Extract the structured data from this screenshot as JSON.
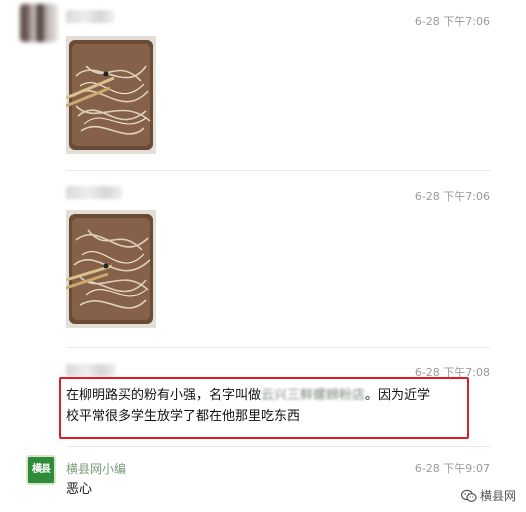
{
  "messages": [
    {
      "time": "6-28 下午7:06"
    },
    {
      "time": "6-28 下午7:06"
    },
    {
      "time": "6-28 下午7:08",
      "text_before": "在柳明路买的粉有小强，名字叫做",
      "text_redacted": "云兴三鲜螺蛳粉店",
      "text_after": "。因为近学",
      "text_line2": "校平常很多学生放学了都在他那里吃东西"
    },
    {
      "sender": "横县网小编",
      "avatar_text": "横县网",
      "time": "6-28 下午9:07",
      "text": "恶心"
    }
  ],
  "watermark": {
    "text": "横县网",
    "icon": "wechat-official-account-icon"
  },
  "colors": {
    "highlight": "#dc1f26",
    "logo_green": "#2e8b3a"
  }
}
